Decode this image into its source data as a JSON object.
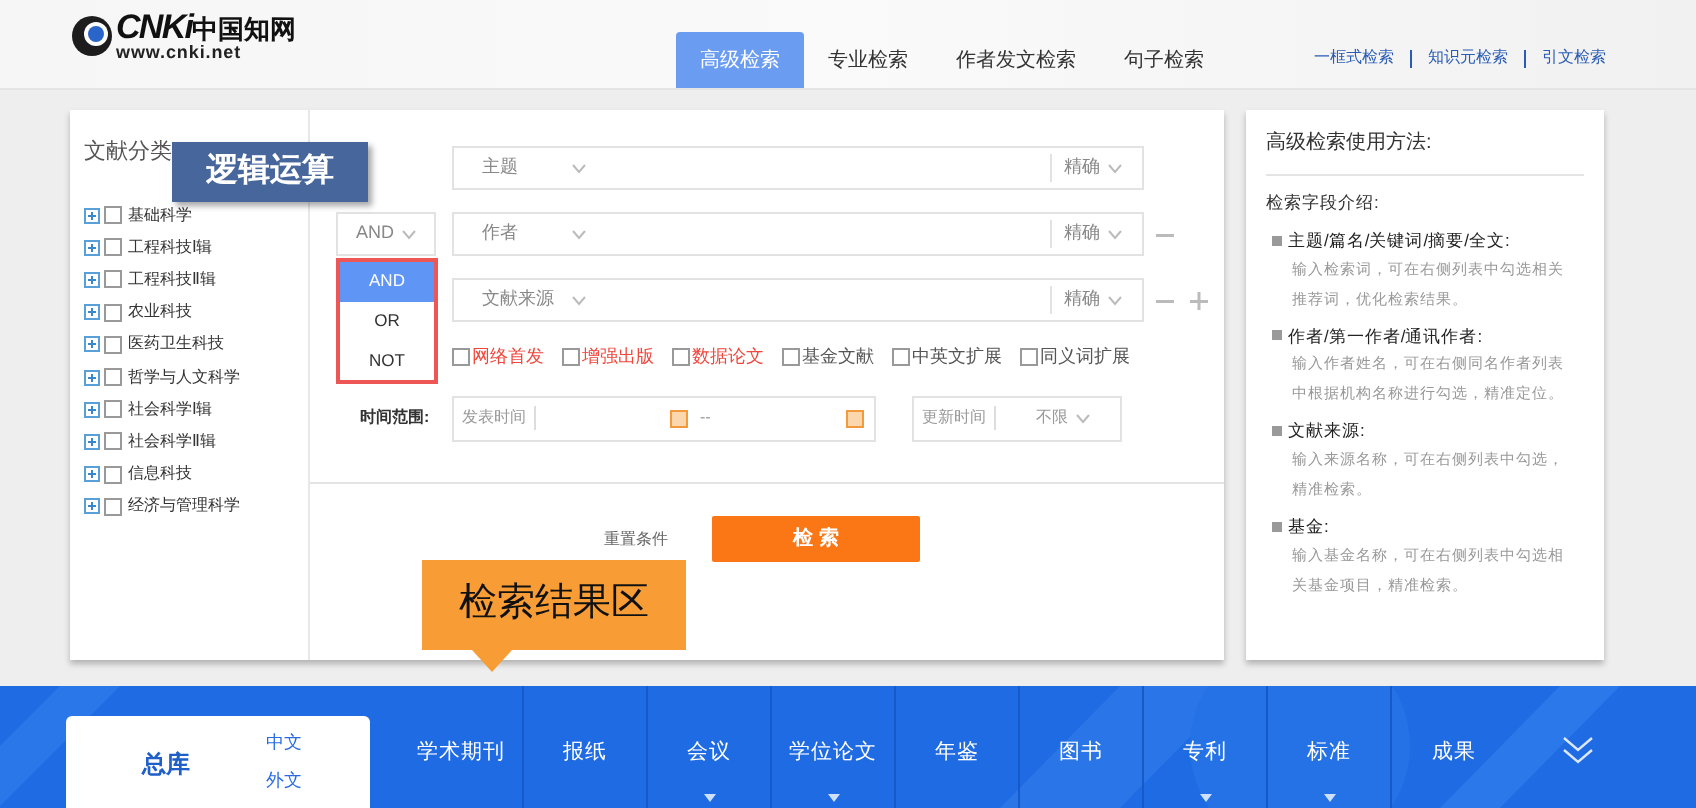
{
  "header": {
    "logo": {
      "mark": "CNKi",
      "name": "中国知网",
      "url": "www.cnki.net"
    },
    "tabs": [
      {
        "label": "高级检索",
        "selected": true
      },
      {
        "label": "专业检索",
        "selected": false
      },
      {
        "label": "作者发文检索",
        "selected": false
      },
      {
        "label": "句子检索",
        "selected": false
      }
    ],
    "links": [
      "一框式检索",
      "知识元检索",
      "引文检索"
    ]
  },
  "category": {
    "title": "文献分类",
    "items": [
      {
        "label": "基础科学",
        "checked": false
      },
      {
        "label": "工程科技Ⅰ辑",
        "checked": false
      },
      {
        "label": "工程科技Ⅱ辑",
        "checked": false
      },
      {
        "label": "农业科技",
        "checked": false
      },
      {
        "label": "医药卫生科技",
        "checked": false
      },
      {
        "label": "哲学与人文科学",
        "checked": false
      },
      {
        "label": "社会科学Ⅰ辑",
        "checked": false
      },
      {
        "label": "社会科学Ⅱ辑",
        "checked": false
      },
      {
        "label": "信息科技",
        "checked": false
      },
      {
        "label": "经济与管理科学",
        "checked": false
      }
    ]
  },
  "logic_label": "逻辑运算",
  "search_rows": [
    {
      "field": "主题",
      "match": "精确",
      "removable": false,
      "addable": false
    },
    {
      "operator": "AND",
      "field": "作者",
      "match": "精确",
      "removable": true,
      "addable": false
    },
    {
      "field": "文献来源",
      "match": "精确",
      "removable": true,
      "addable": true
    }
  ],
  "operator_menu": [
    {
      "label": "AND",
      "selected": true
    },
    {
      "label": "OR",
      "selected": false
    },
    {
      "label": "NOT",
      "selected": false
    }
  ],
  "options": [
    {
      "label": "网络首发",
      "checked": false,
      "color": "#f0463c"
    },
    {
      "label": "增强出版",
      "checked": false,
      "color": "#f0463c"
    },
    {
      "label": "数据论文",
      "checked": false,
      "color": "#f0463c"
    },
    {
      "label": "基金文献",
      "checked": false,
      "color": "#555555"
    },
    {
      "label": "中英文扩展",
      "checked": false,
      "color": "#555555"
    },
    {
      "label": "同义词扩展",
      "checked": false,
      "color": "#555555"
    }
  ],
  "time_range": {
    "label": "时间范围:",
    "publish_label": "发表时间",
    "separator": "--",
    "update_label": "更新时间",
    "update_value": "不限"
  },
  "reset": "重置条件",
  "search_button": "检 索",
  "callout": "检索结果区",
  "help": {
    "title": "高级检索使用方法:",
    "subtitle": "检索字段介绍:",
    "sections": [
      {
        "heading": "主题/篇名/关键词/摘要/全文:",
        "text": "输入检索词，可在右侧列表中勾选相关推荐词，优化检索结果。"
      },
      {
        "heading": "作者/第一作者/通讯作者:",
        "text": "输入作者姓名，可在右侧同名作者列表中根据机构名称进行勾选，精准定位。"
      },
      {
        "heading": "文献来源:",
        "text": "输入来源名称，可在右侧列表中勾选，精准检索。"
      },
      {
        "heading": "基金:",
        "text": "输入基金名称，可在右侧列表中勾选相关基金项目，精准检索。"
      }
    ]
  },
  "bottom_nav": {
    "main": "总库",
    "langs": [
      "中文",
      "外文"
    ],
    "items": [
      {
        "label": "学术期刊",
        "has_menu": false
      },
      {
        "label": "报纸",
        "has_menu": false
      },
      {
        "label": "会议",
        "has_menu": true
      },
      {
        "label": "学位论文",
        "has_menu": true
      },
      {
        "label": "年鉴",
        "has_menu": false
      },
      {
        "label": "图书",
        "has_menu": false
      },
      {
        "label": "专利",
        "has_menu": true
      },
      {
        "label": "标准",
        "has_menu": true
      },
      {
        "label": "成果",
        "has_menu": false
      }
    ]
  }
}
